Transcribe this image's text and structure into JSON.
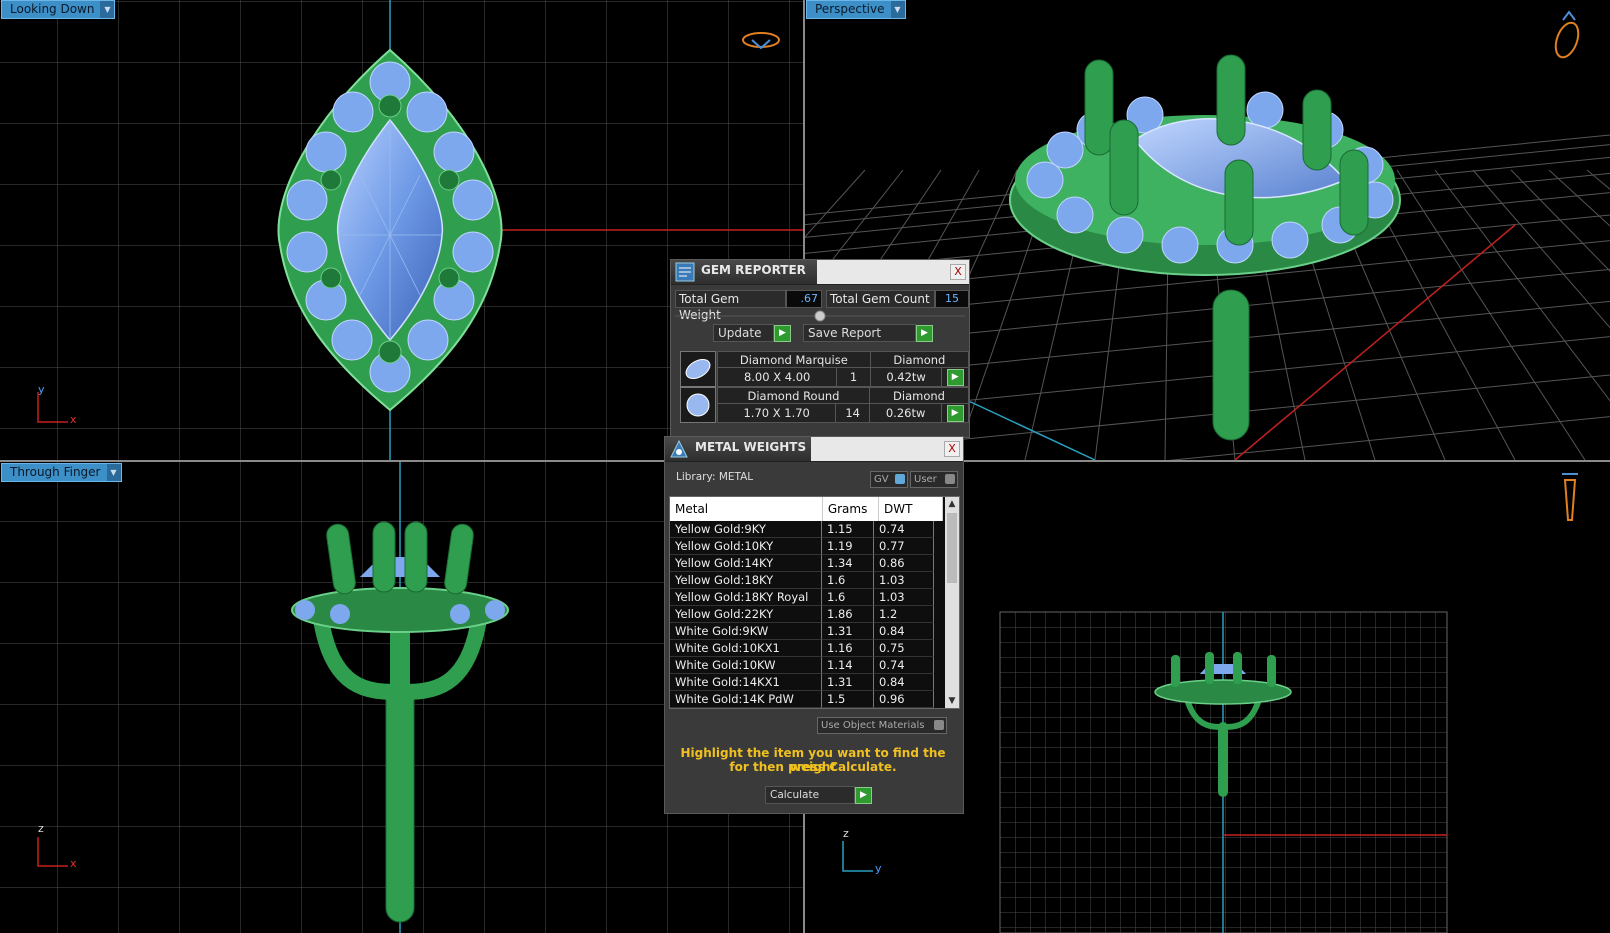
{
  "viewports": {
    "top_left": {
      "label": "Looking Down",
      "axis_v": "y",
      "axis_h": "x"
    },
    "top_right": {
      "label": "Perspective"
    },
    "bottom_left": {
      "label": "Through Finger",
      "axis_v": "z",
      "axis_h": "x"
    },
    "bottom_right": {
      "axis_v": "z",
      "axis_h": "y"
    }
  },
  "gem_reporter": {
    "title": "GEM REPORTER",
    "close": "X",
    "total_weight_label": "Total Gem Weight",
    "total_weight_value": ".67",
    "total_count_label": "Total Gem Count",
    "total_count_value": "15",
    "update_label": "Update",
    "save_label": "Save Report",
    "gems": [
      {
        "name": "Diamond Marquise",
        "material": "Diamond",
        "size": "8.00 X 4.00",
        "count": "1",
        "weight": "0.42tw"
      },
      {
        "name": "Diamond Round",
        "material": "Diamond",
        "size": "1.70 X 1.70",
        "count": "14",
        "weight": "0.26tw"
      }
    ]
  },
  "metal_weights": {
    "title": "METAL WEIGHTS",
    "close": "X",
    "library_label": "Library: METAL",
    "gv_label": "GV",
    "user_label": "User",
    "columns": [
      "Metal",
      "Grams",
      "DWT"
    ],
    "rows": [
      [
        "Yellow Gold:9KY",
        "1.15",
        "0.74"
      ],
      [
        "Yellow Gold:10KY",
        "1.19",
        "0.77"
      ],
      [
        "Yellow Gold:14KY",
        "1.34",
        "0.86"
      ],
      [
        "Yellow Gold:18KY",
        "1.6",
        "1.03"
      ],
      [
        "Yellow Gold:18KY Royal",
        "1.6",
        "1.03"
      ],
      [
        "Yellow Gold:22KY",
        "1.86",
        "1.2"
      ],
      [
        "White Gold:9KW",
        "1.31",
        "0.84"
      ],
      [
        "White Gold:10KX1",
        "1.16",
        "0.75"
      ],
      [
        "White Gold:10KW",
        "1.14",
        "0.74"
      ],
      [
        "White Gold:14KX1",
        "1.31",
        "0.84"
      ],
      [
        "White Gold:14K PdW",
        "1.5",
        "0.96"
      ]
    ],
    "use_materials_label": "Use Object Materials",
    "hint_line1": "Highlight the item you want to find the weight",
    "hint_line2": "for then press Calculate.",
    "calculate_label": "Calculate"
  },
  "colors": {
    "metal": "#2f9e4e",
    "gem": "#7ea8ee",
    "grid": "#4a4a4a",
    "axis_x": "#c42020",
    "axis_y": "#2aa0c0",
    "label_bg": "#3d8fc8",
    "hint": "#f0c020"
  }
}
